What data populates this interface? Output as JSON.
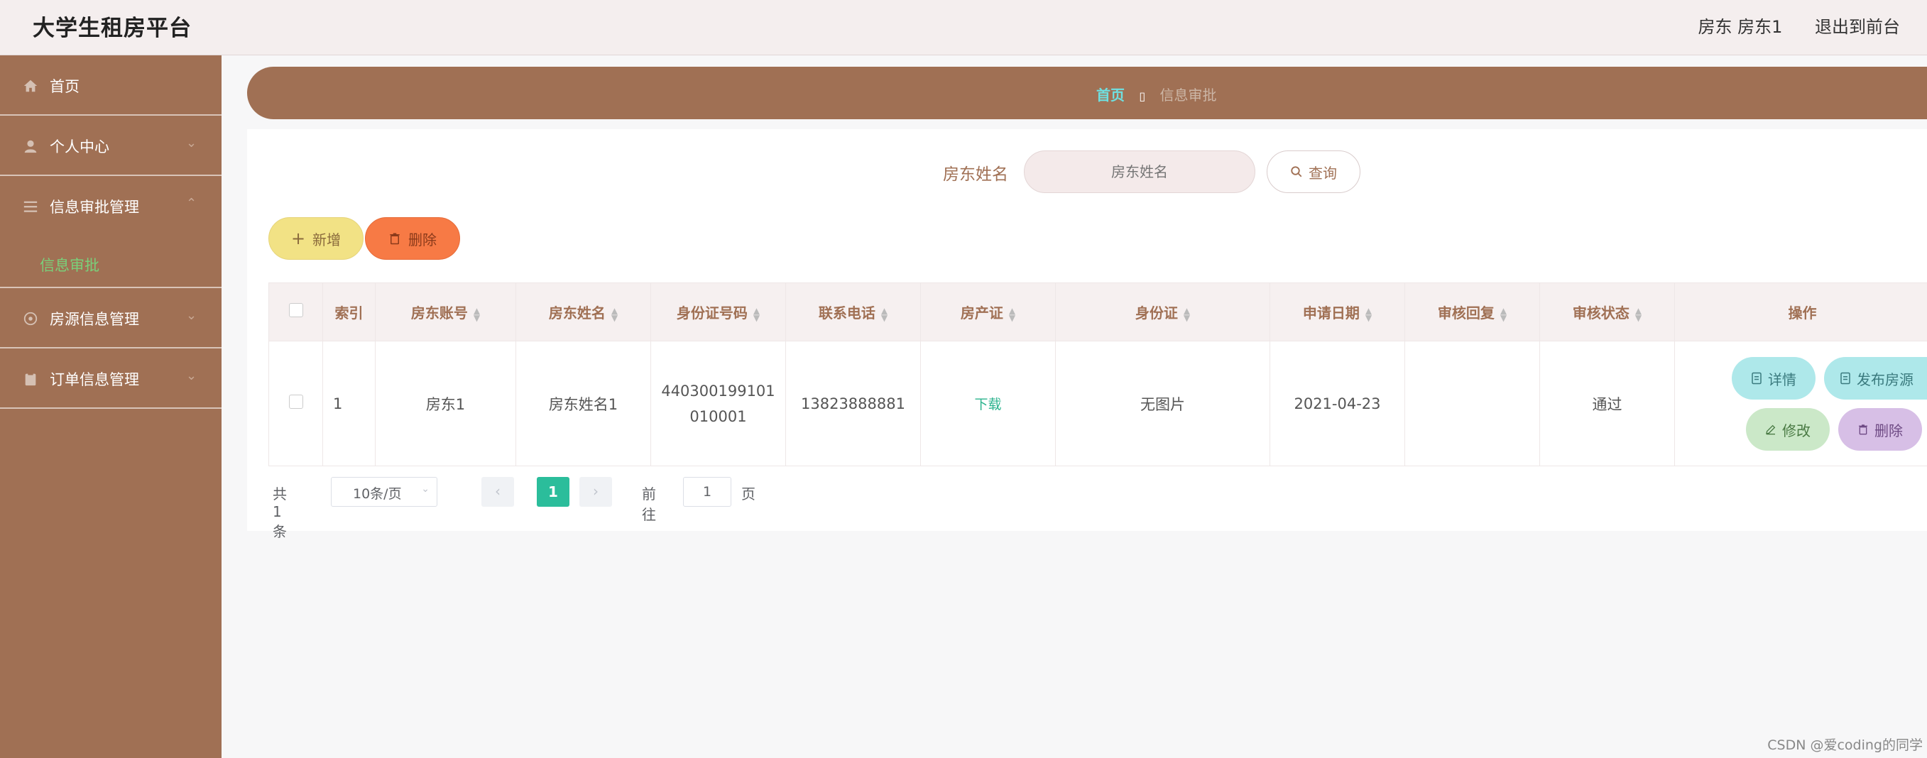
{
  "app": {
    "title": "大学生租房平台"
  },
  "header": {
    "user": "房东 房东1",
    "back": "退出到前台"
  },
  "sidebar": {
    "items": [
      {
        "label": "首页"
      },
      {
        "label": "个人中心"
      },
      {
        "label": "信息审批管理",
        "sub": "信息审批"
      },
      {
        "label": "房源信息管理"
      },
      {
        "label": "订单信息管理"
      }
    ]
  },
  "breadcrumb": {
    "home": "首页",
    "current": "信息审批"
  },
  "search": {
    "label": "房东姓名",
    "placeholder": "房东姓名",
    "button": "查询"
  },
  "actions": {
    "add": "新增",
    "delete": "删除"
  },
  "table": {
    "headers": [
      "索引",
      "房东账号",
      "房东姓名",
      "身份证号码",
      "联系电话",
      "房产证",
      "身份证",
      "申请日期",
      "审核回复",
      "审核状态",
      "操作"
    ],
    "rows": [
      {
        "index": "1",
        "account": "房东1",
        "name": "房东姓名1",
        "id_line1": "440300199101",
        "id_line2": "010001",
        "phone": "13823888881",
        "deed": "下载",
        "id_card": "无图片",
        "date": "2021-04-23",
        "reply": "",
        "status": "通过",
        "ops": {
          "detail": "详情",
          "publish": "发布房源",
          "edit": "修改",
          "remove": "删除"
        }
      }
    ]
  },
  "pager": {
    "total": "共 1 条",
    "page_size": "10条/页",
    "current": "1",
    "goto": "前往",
    "goto_value": "1",
    "unit": "页"
  },
  "watermark": "CSDN @爱coding的同学",
  "colors": {
    "sidebar": "#a07054",
    "accent": "#2bbd9b",
    "header_bg": "#f4eeee"
  }
}
